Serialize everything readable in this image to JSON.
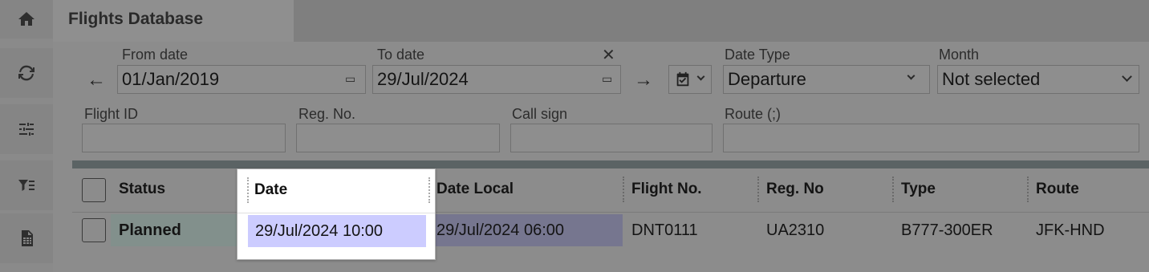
{
  "tab": {
    "title": "Flights Database"
  },
  "rail": {
    "home": "home-icon",
    "refresh": "refresh-icon",
    "settings": "sliders-icon",
    "filter": "filter-list-icon",
    "export": "spreadsheet-icon"
  },
  "filters": {
    "from_date": {
      "label": "From date",
      "value": "01/Jan/2019"
    },
    "to_date": {
      "label": "To date",
      "value": "29/Jul/2024",
      "clear": "✕"
    },
    "date_type": {
      "label": "Date Type",
      "value": "Departure"
    },
    "month": {
      "label": "Month",
      "value": "Not selected"
    },
    "flight_id": {
      "label": "Flight ID",
      "value": ""
    },
    "reg_no": {
      "label": "Reg. No.",
      "value": ""
    },
    "call_sign": {
      "label": "Call sign",
      "value": ""
    },
    "route": {
      "label": "Route (;)",
      "value": ""
    }
  },
  "table": {
    "columns": [
      "Status",
      "Date",
      "Date Local",
      "Flight No.",
      "Reg. No",
      "Type",
      "Route"
    ],
    "rows": [
      {
        "status": "Planned",
        "date": "29/Jul/2024 10:00",
        "date_local": "29/Jul/2024 06:00",
        "flight_no": "DNT0111",
        "reg_no": "UA2310",
        "type": "B777-300ER",
        "route": "JFK-HND"
      }
    ]
  },
  "colors": {
    "status_highlight": "#82908c",
    "date_highlight": "#ccccff",
    "date_local_highlight": "#76768f"
  }
}
